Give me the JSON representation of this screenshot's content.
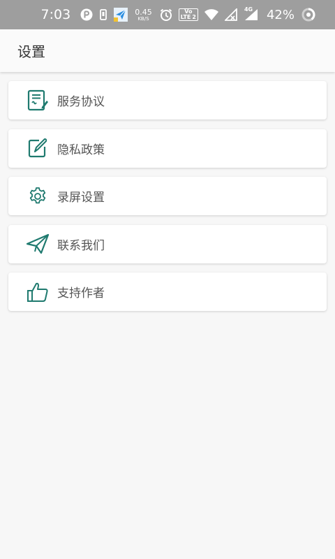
{
  "status_bar": {
    "time": "7:03",
    "net_speed_value": "0.45",
    "net_speed_unit": "KB/S",
    "volte_top": "Vo",
    "volte_bottom": "LTE",
    "sim_number": "2",
    "network_badge": "4G",
    "battery_percent": "42%",
    "icons": [
      "notification-p-icon",
      "phone-vibrate-icon",
      "app-paper-plane-icon",
      "alarm-icon",
      "volte-icon",
      "wifi-icon",
      "signal-1-icon",
      "signal-2-icon",
      "battery-ring-icon"
    ]
  },
  "app_bar": {
    "title": "设置"
  },
  "menu": {
    "items": [
      {
        "label": "服务协议",
        "icon": "document-sign-icon"
      },
      {
        "label": "隐私政策",
        "icon": "edit-pen-icon"
      },
      {
        "label": "录屏设置",
        "icon": "gear-icon"
      },
      {
        "label": "联系我们",
        "icon": "paper-plane-icon"
      },
      {
        "label": "支持作者",
        "icon": "thumbs-up-icon"
      }
    ]
  },
  "colors": {
    "accent": "#1f7a6f",
    "status_bar": "#9e9e9e",
    "background": "#f7f7f7"
  }
}
